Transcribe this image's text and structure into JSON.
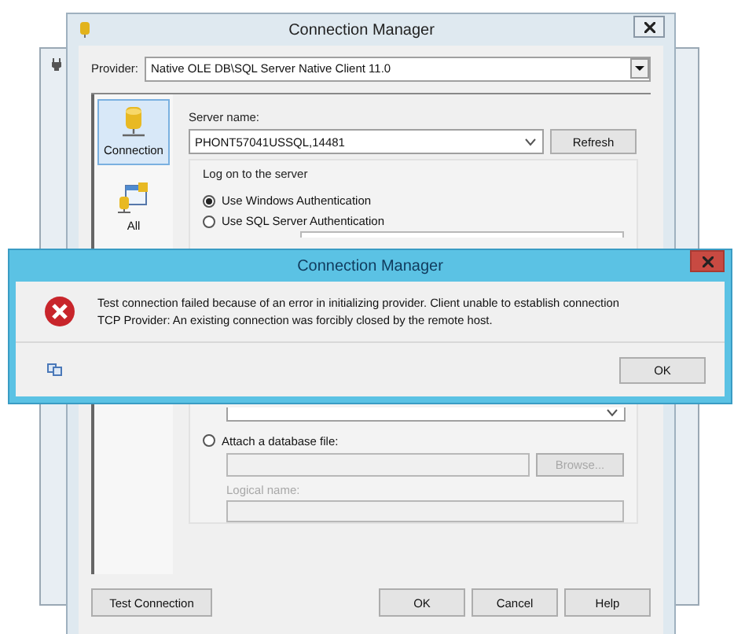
{
  "dialog": {
    "title": "Connection Manager",
    "provider_label": "Provider:",
    "provider": "Native OLE DB\\SQL Server Native Client 11.0",
    "pages": [
      {
        "label": "Connection",
        "selected": true,
        "kind": "connection"
      },
      {
        "label": "All",
        "selected": false,
        "kind": "all"
      }
    ],
    "server_label": "Server name:",
    "server": "PHONT57041USSQL,14481",
    "refresh": "Refresh",
    "logon_group": "Log on to the server",
    "auth_options": [
      {
        "label": "Use Windows Authentication",
        "selected": true
      },
      {
        "label": "Use SQL Server Authentication",
        "selected": false
      }
    ],
    "attach": {
      "label": "Attach a database file:",
      "selected": false,
      "disabled": true,
      "browse": "Browse...",
      "logical_name_label": "Logical name:"
    },
    "buttons": [
      "Test Connection",
      "OK",
      "Cancel",
      "Help"
    ]
  },
  "error_dialog": {
    "title": "Connection Manager",
    "message": [
      "Test connection failed because of an error in initializing provider. Client unable to establish connection",
      "TCP Provider: An existing connection was forcibly closed by the remote host."
    ],
    "button": "OK"
  }
}
